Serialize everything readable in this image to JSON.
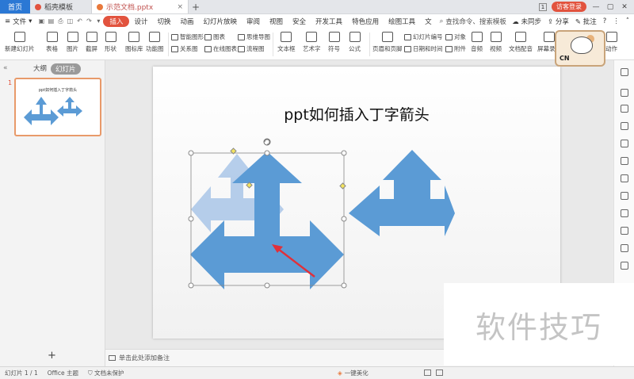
{
  "tabs": {
    "home": "首页",
    "template": "稻壳模板",
    "document": "示范文档.pptx",
    "count": "1",
    "guest_login": "访客登录"
  },
  "menu": {
    "file": "文件",
    "items": [
      "插入",
      "设计",
      "切换",
      "动画",
      "幻灯片放映",
      "审阅",
      "视图",
      "安全",
      "开发工具",
      "特色应用",
      "绘图工具",
      "文"
    ],
    "active_index": 0,
    "search": "查找命令、搜索模板",
    "sync": "未同步",
    "share": "分享",
    "annotate": "批注"
  },
  "toolbar": {
    "new_slide": "新建幻灯片",
    "table": "表格",
    "picture": "图片",
    "screenshot": "截屏",
    "shape": "形状",
    "icon_lib": "图标库",
    "function_chart": "功能图",
    "smart_art": "智能图形",
    "chart": "图表",
    "mind_map": "思维导图",
    "relation_chart": "关系图",
    "online_chart": "在线图表",
    "flow_chart": "流程图",
    "textbox": "文本框",
    "art_text": "艺术字",
    "symbol": "符号",
    "formula": "公式",
    "header_footer": "页眉和页脚",
    "slide_number": "幻灯片编号",
    "object": "对象",
    "date_time": "日期和时间",
    "attachment": "附件",
    "audio": "音频",
    "video": "视频",
    "doc_dub": "文档配音",
    "screen_record": "屏幕录制",
    "action": "动作"
  },
  "mascot": {
    "label": "CN"
  },
  "left_panel": {
    "outline_tab": "大纲",
    "slides_tab": "幻灯片",
    "slide_number": "1",
    "thumb_title": "ppt如何插入丁字箭头"
  },
  "slide": {
    "title": "ppt如何插入丁字箭头"
  },
  "notes": {
    "placeholder": "单击此处添加备注"
  },
  "status": {
    "slide_info": "幻灯片 1 / 1",
    "theme": "Office 主题",
    "protection": "文档未保护",
    "beautify": "一键美化"
  },
  "watermark": {
    "text": "软件技巧"
  },
  "colors": {
    "accent": "#e2533e",
    "arrow_fill": "#5b9bd5",
    "arrow_ghost": "#a9c6e8",
    "red_arrow": "#e0303a"
  }
}
